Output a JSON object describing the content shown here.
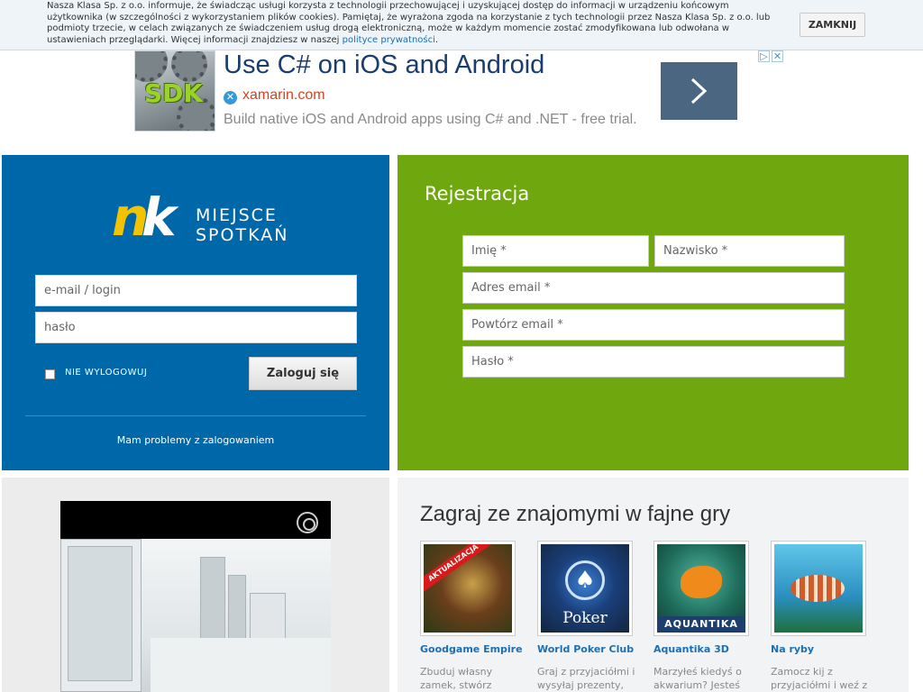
{
  "cookie": {
    "text": "Nasza Klasa Sp. z o.o. informuje, że świadcząc usługi korzysta z technologii przechowującej i uzyskującej dostęp do informacji w urządzeniu końcowym użytkownika (w szczególności z wykorzystaniem plików cookies). Pamiętaj, że wyrażona zgoda na korzystanie z tych technologii przez Nasza Klasa Sp. z o.o. lub podmioty trzecie, w celach związanych ze świadczeniem usług drogą elektroniczną, może w każdym momencie zostać zmodyfikowana lub odwołana w ustawieniach przeglądarki. Więcej informacji znajdziesz w naszej ",
    "link": "polityce prywatności",
    "suffix": ".",
    "close_label": "ZAMKNIJ"
  },
  "ad": {
    "image_text": "SDK",
    "title": "Use C# on iOS and Android",
    "site": "xamarin.com",
    "description": "Build native iOS and Android apps using C# and .NET - free trial."
  },
  "login": {
    "logo_mark": "nk",
    "logo_line1": "MIEJSCE",
    "logo_line2": "SPOTKAŃ",
    "email_placeholder": "e-mail / login",
    "password_placeholder": "hasło",
    "remember_label": "NIE WYLOGOWUJ",
    "submit_label": "Zaloguj się",
    "help_link": "Mam problemy z zalogowaniem"
  },
  "register": {
    "title": "Rejestracja",
    "first_name": "Imię *",
    "last_name": "Nazwisko *",
    "email": "Adres email *",
    "email_repeat": "Powtórz email *",
    "password": "Hasło *"
  },
  "games": {
    "title": "Zagraj ze znajomymi w fajne gry",
    "items": [
      {
        "name": "Goodgame Empire",
        "desc": "Zbuduj własny zamek, stwórz",
        "badge": "AKTUALIZACJA"
      },
      {
        "name": "World Poker Club",
        "desc": "Graj z przyjaciółmi i wysyłaj prezenty,",
        "art_label": "Poker"
      },
      {
        "name": "Aquantika 3D",
        "desc": "Marzyłeś kiedyś o akwarium? Jesteś",
        "art_label": "AQUANTIKA"
      },
      {
        "name": "Na ryby",
        "desc": "Zamocz kij z przyjaciółmi i weź z"
      }
    ]
  },
  "colors": {
    "login_bg": "#0068a8",
    "register_bg": "#6fa70e",
    "logo_accent": "#f4c300",
    "link": "#1a6fb5"
  }
}
